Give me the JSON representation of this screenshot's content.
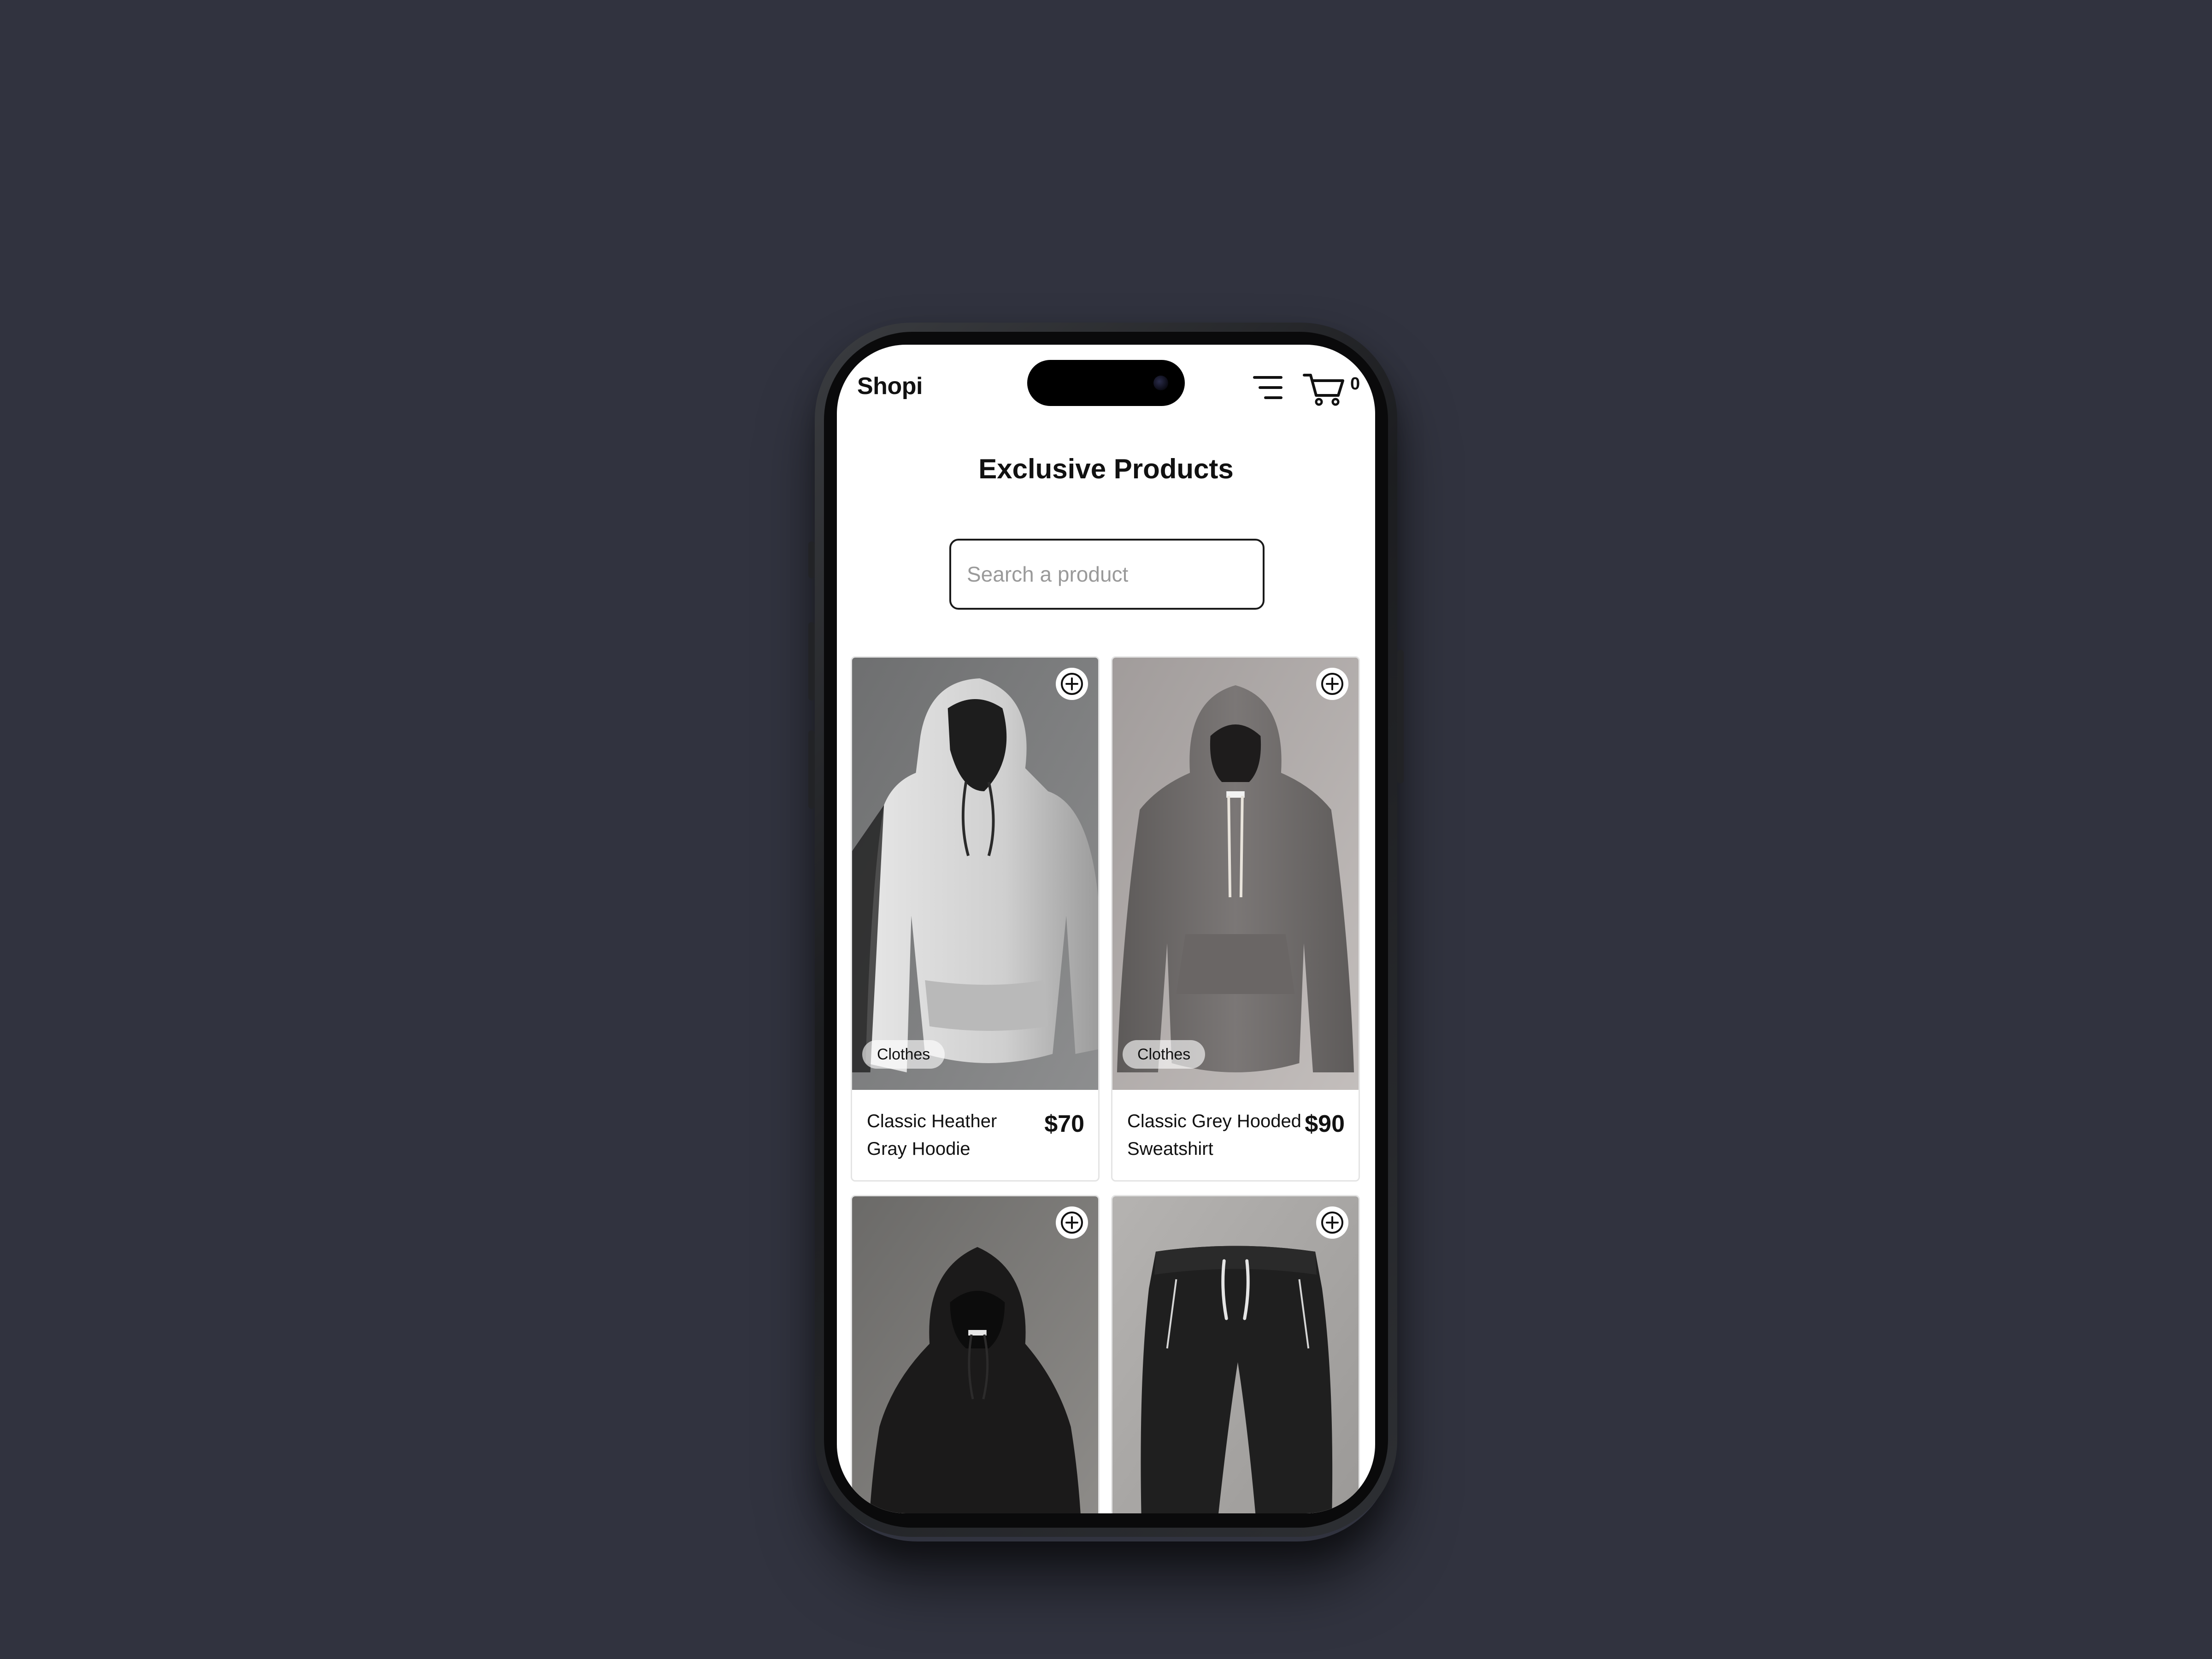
{
  "app": {
    "brand": "Shopi"
  },
  "header": {
    "menu_icon": "hamburger-menu-icon",
    "cart_icon": "shopping-cart-icon",
    "cart_count": "0"
  },
  "main": {
    "title": "Exclusive Products"
  },
  "search": {
    "placeholder": "Search a product",
    "value": ""
  },
  "products": [
    {
      "name": "Classic Heather Gray Hoodie",
      "price": "$70",
      "category": "Clothes",
      "image": "light-gray-hoodie"
    },
    {
      "name": "Classic Grey Hooded Sweatshirt",
      "price": "$90",
      "category": "Clothes",
      "image": "gray-hoodie"
    },
    {
      "name": "",
      "price": "",
      "category": "",
      "image": "black-hoodie"
    },
    {
      "name": "",
      "price": "",
      "category": "",
      "image": "black-joggers"
    }
  ],
  "colors": {
    "background": "#31333f",
    "screen": "#ffffff",
    "text": "#111111"
  }
}
